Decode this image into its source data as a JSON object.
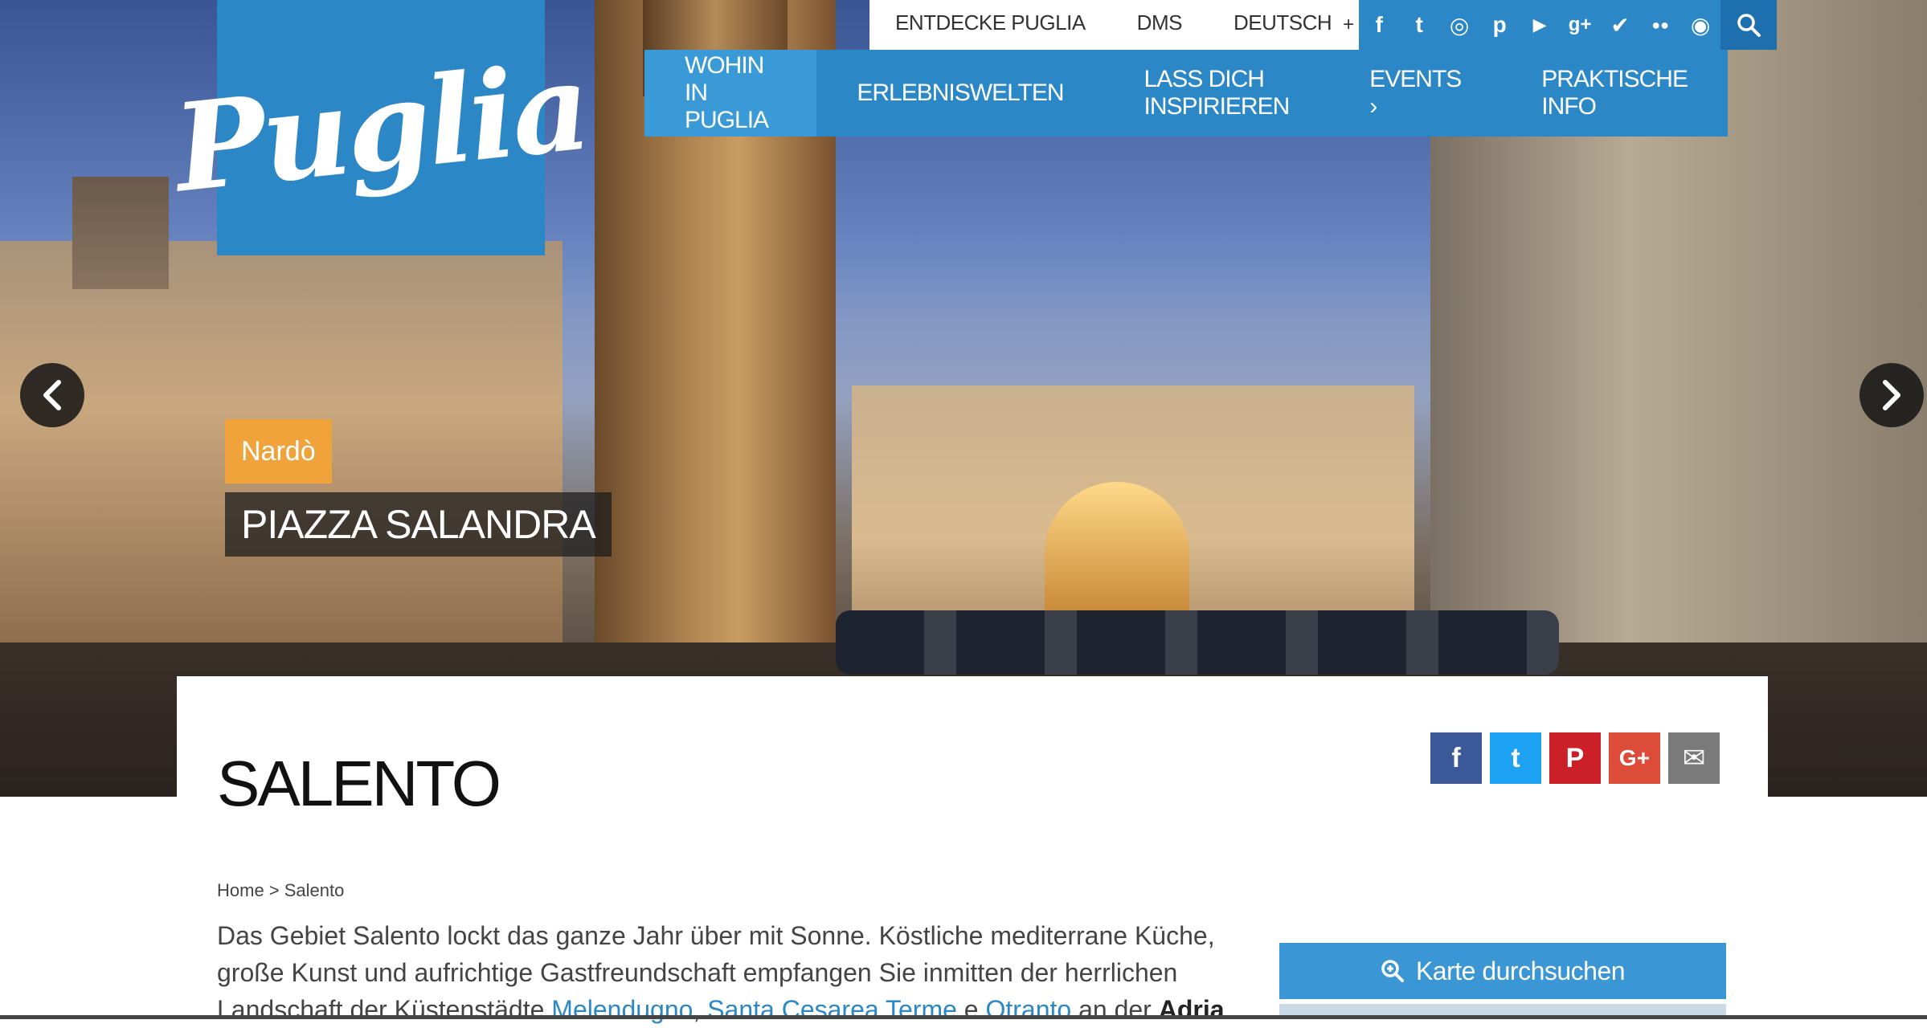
{
  "logo": {
    "text": "Puglia"
  },
  "utility": {
    "links": [
      "ENTDECKE PUGLIA",
      "DMS",
      "DEUTSCH"
    ],
    "language_more": "+"
  },
  "social": {
    "icons": [
      "facebook-icon",
      "twitter-icon",
      "instagram-icon",
      "pinterest-icon",
      "youtube-icon",
      "google-plus-icon",
      "tripadvisor-icon",
      "flickr-icon",
      "foursquare-icon"
    ],
    "glyphs": [
      "f",
      "t",
      "◎",
      "p",
      "▶",
      "g+",
      "✔",
      "●●",
      "◉"
    ]
  },
  "nav": {
    "items": [
      "WOHIN IN PUGLIA",
      "ERLEBNISWELTEN",
      "LASS DICH INSPIRIEREN",
      "EVENTS ›",
      "PRAKTISCHE INFO"
    ]
  },
  "hero": {
    "tag": "Nardò",
    "title": "PIAZZA SALANDRA"
  },
  "page": {
    "title": "SALENTO",
    "breadcrumb": "Home > Salento",
    "intro_1": "Das Gebiet Salento lockt das ganze Jahr über mit Sonne. Köstliche mediterrane Küche, große Kunst und aufrichtige Gastfreundschaft empfangen Sie inmitten der herrlichen Landschaft der Küstenstädte ",
    "link_1": "Melendugno",
    "sep_1": ", ",
    "link_2": "Santa Cesarea Terme",
    "sep_2": " e ",
    "link_3": "Otranto",
    "intro_2": " an der ",
    "bold_1": "Adria"
  },
  "share": {
    "buttons": [
      {
        "icon": "facebook-share-icon",
        "glyph": "f",
        "color": "#3b5998"
      },
      {
        "icon": "twitter-share-icon",
        "glyph": "t",
        "color": "#1da1f2"
      },
      {
        "icon": "pinterest-share-icon",
        "glyph": "P",
        "color": "#cb2027"
      },
      {
        "icon": "google-plus-share-icon",
        "glyph": "G+",
        "color": "#dd4b39"
      },
      {
        "icon": "email-share-icon",
        "glyph": "✉",
        "color": "#7a7a7a"
      }
    ]
  },
  "map": {
    "button_label": "Karte durchsuchen"
  },
  "colors": {
    "brand_blue": "#2c87c7",
    "nav_active": "#3a9ad8",
    "tag_orange": "#f0a33a",
    "link_blue": "#2c87c7"
  }
}
